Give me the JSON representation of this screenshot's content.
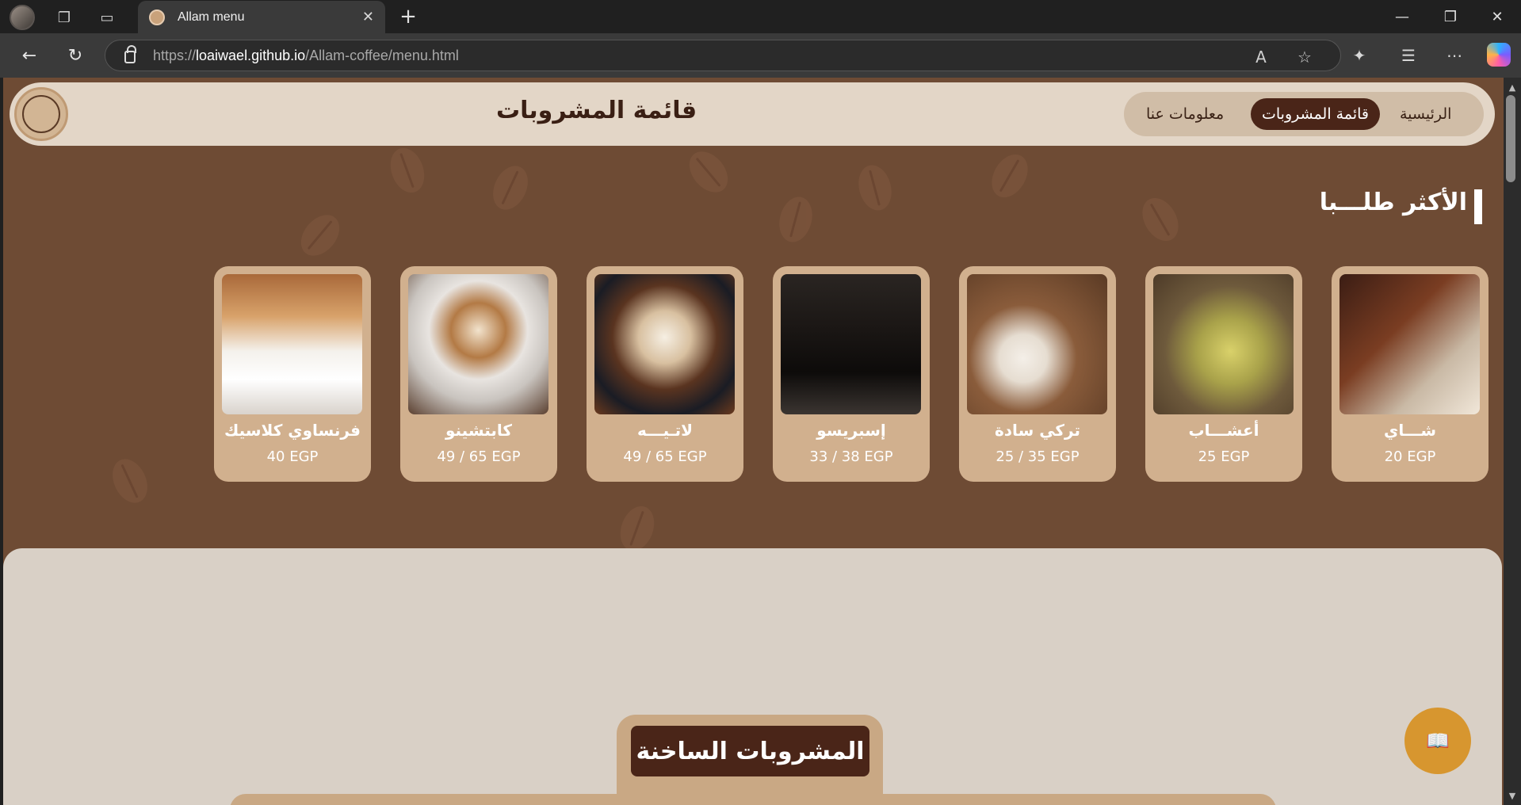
{
  "browser": {
    "tab_title": "Allam menu",
    "url_scheme": "https://",
    "url_host": "loaiwael.github.io",
    "url_path": "/Allam-coffee/menu.html"
  },
  "header": {
    "page_title": "قائمة المشروبات",
    "nav": [
      {
        "label": "الرئيسية",
        "active": false
      },
      {
        "label": "قائمة المشروبات",
        "active": true
      },
      {
        "label": "معلومات عنا",
        "active": false
      }
    ]
  },
  "popular": {
    "heading": "الأكثر طلـــبا",
    "items": [
      {
        "name": "شـــاي",
        "price": "20 EGP"
      },
      {
        "name": "أعشـــاب",
        "price": "25 EGP"
      },
      {
        "name": "تركي سادة",
        "price": "25 / 35 EGP"
      },
      {
        "name": "إسبريسو",
        "price": "33 / 38 EGP"
      },
      {
        "name": "لاتـيـــه",
        "price": "49 / 65 EGP"
      },
      {
        "name": "كابتشينو",
        "price": "49 / 65 EGP"
      },
      {
        "name": "فرنساوي كلاسيك",
        "price": "40 EGP"
      }
    ]
  },
  "hot_drinks": {
    "title": "المشروبات الساخنة"
  },
  "colors": {
    "brown_bg": "#6e4b34",
    "cream": "#e3d6c7",
    "card": "#d1b08e",
    "dark_brown": "#4a2518",
    "fab": "#d7962f"
  },
  "icons": {
    "fab": "book-icon"
  }
}
